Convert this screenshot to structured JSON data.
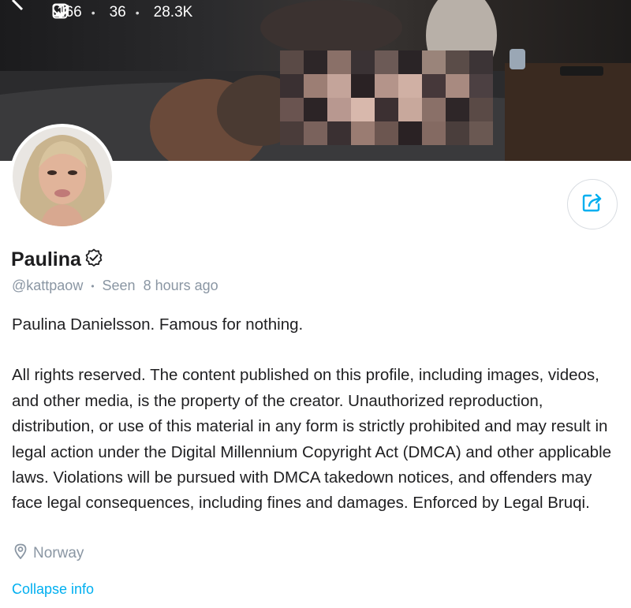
{
  "header": {
    "stats": [
      {
        "icon": "image-icon",
        "value": "166"
      },
      {
        "icon": "video-icon",
        "value": "36"
      },
      {
        "icon": "heart-icon",
        "value": "28.3K"
      }
    ]
  },
  "profile": {
    "name": "Paulina",
    "verified_icon": "verified-badge-icon",
    "handle": "@kattpaow",
    "separator": "•",
    "last_seen": "Seen  8 hours ago",
    "bio_line1": "Paulina Danielsson. Famous for nothing.",
    "bio_line2": "All rights reserved. The content published on this profile, including images, videos, and other media, is the property of the creator. Unauthorized reproduction, distribution, or use of this material in any form is strictly prohibited and may result in legal action under the Digital Millennium Copyright Act (DMCA) and other applicable laws. Violations will be pursued with DMCA takedown notices, and offenders may face legal consequences, including fines and damages. Enforced by Legal Bruqi.",
    "location": "Norway",
    "collapse_label": "Collapse info"
  },
  "actions": {
    "share_icon": "share-icon"
  },
  "colors": {
    "accent": "#00aff0",
    "muted": "#8a96a3",
    "text": "#1f1f21"
  }
}
